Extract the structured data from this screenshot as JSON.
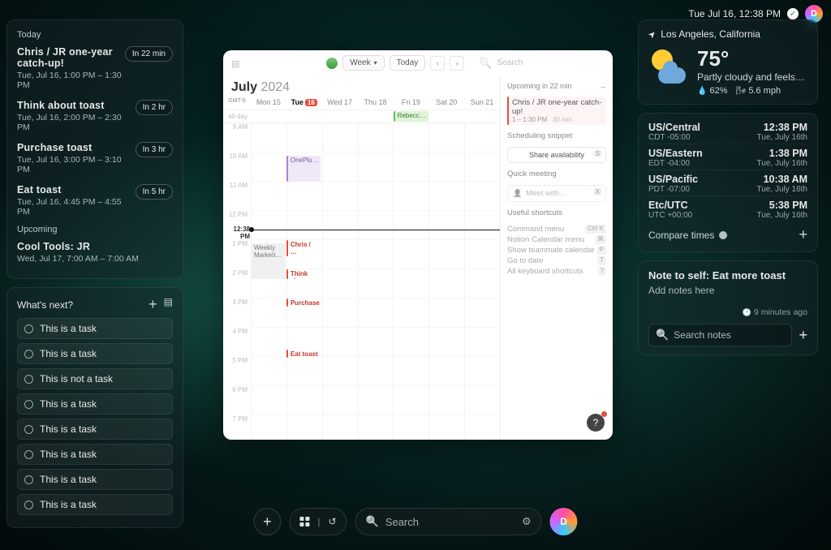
{
  "statusbar": {
    "datetime": "Tue Jul 16,  12:38 PM",
    "avatar_letter": "D"
  },
  "agenda": {
    "today_label": "Today",
    "today": [
      {
        "title": "Chris / JR one-year catch-up!",
        "time": "Tue, Jul 16, 1:00 PM – 1:30 PM",
        "pill": "In 22 min"
      },
      {
        "title": "Think about toast",
        "time": "Tue, Jul 16, 2:00 PM – 2:30 PM",
        "pill": "In 2 hr"
      },
      {
        "title": "Purchase toast",
        "time": "Tue, Jul 16, 3:00 PM – 3:10 PM",
        "pill": "In 3 hr"
      },
      {
        "title": "Eat toast",
        "time": "Tue, Jul 16, 4:45 PM – 4:55 PM",
        "pill": "In 5 hr"
      }
    ],
    "upcoming_label": "Upcoming",
    "upcoming": [
      {
        "title": "Cool Tools: JR",
        "time": "Wed, Jul 17, 7:00 AM – 7:00 AM"
      }
    ]
  },
  "tasks": {
    "header": "What's next?",
    "items": [
      "This is a task",
      "This is a task",
      "This is not a task",
      "This is a task",
      "This is a task",
      "This is a task",
      "This is a task",
      "This is a task"
    ]
  },
  "weather": {
    "location": "Los Angeles, California",
    "temp": "75°",
    "desc": "Partly cloudy and feels…",
    "humidity": "62%",
    "wind": "5.6 mph"
  },
  "timezones": {
    "items": [
      {
        "zone": "US/Central",
        "offset": "CDT -05:00",
        "time": "12:38 PM",
        "date": "Tue, July 16th"
      },
      {
        "zone": "US/Eastern",
        "offset": "EDT -04:00",
        "time": "1:38 PM",
        "date": "Tue, July 16th"
      },
      {
        "zone": "US/Pacific",
        "offset": "PDT -07:00",
        "time": "10:38 AM",
        "date": "Tue, July 16th"
      },
      {
        "zone": "Etc/UTC",
        "offset": "UTC +00:00",
        "time": "5:38 PM",
        "date": "Tue, July 16th"
      }
    ],
    "compare_label": "Compare times"
  },
  "notes": {
    "title": "Note to self: Eat more toast",
    "subtitle": "Add notes here",
    "meta": "9 minutes ago",
    "search_placeholder": "Search notes"
  },
  "calendar": {
    "view_label": "Week",
    "today_label": "Today",
    "search_placeholder": "Search",
    "month": "July",
    "year": "2024",
    "gmt_label": "GMT-5",
    "days": [
      "Mon 15",
      "Tue",
      "Wed 17",
      "Thu 18",
      "Fri 19",
      "Sat 20",
      "Sun 21"
    ],
    "today_num": "16",
    "allday_label": "all-day",
    "allday_event": "Rebecc…",
    "hours": [
      "9 AM",
      "10 AM",
      "11 AM",
      "12 PM",
      "1 PM",
      "2 PM",
      "3 PM",
      "4 PM",
      "5 PM",
      "6 PM",
      "7 PM"
    ],
    "now_label": "12:38 PM",
    "events": {
      "oneplus": "OnePlu…",
      "weekly": "Weekly Marketi…",
      "chris": "Chris / …",
      "chris_time": "1 – 1:30 PM",
      "think": "Think abo…",
      "purchase": "Purchase",
      "eat": "Eat toast"
    },
    "sidebar": {
      "upcoming_header": "Upcoming in 22 min",
      "up_title": "Chris / JR one-year catch-up!",
      "up_time": "1 – 1:30 PM",
      "up_dur": "30 min",
      "snippet_header": "Scheduling snippet",
      "share_label": "Share availability",
      "share_key": "S",
      "quick_header": "Quick meeting",
      "meet_placeholder": "Meet with…",
      "meet_key": "X",
      "shortcuts_header": "Useful shortcuts",
      "shortcuts": [
        {
          "label": "Command menu",
          "key": "Ctrl  K"
        },
        {
          "label": "Notion Calendar menu",
          "key": "⌘"
        },
        {
          "label": "Show teammate calendar",
          "key": "P"
        },
        {
          "label": "Go to date",
          "key": "T"
        },
        {
          "label": "All keyboard shortcuts",
          "key": "?"
        }
      ]
    }
  },
  "dock": {
    "search_placeholder": "Search",
    "avatar_letter": "D"
  }
}
